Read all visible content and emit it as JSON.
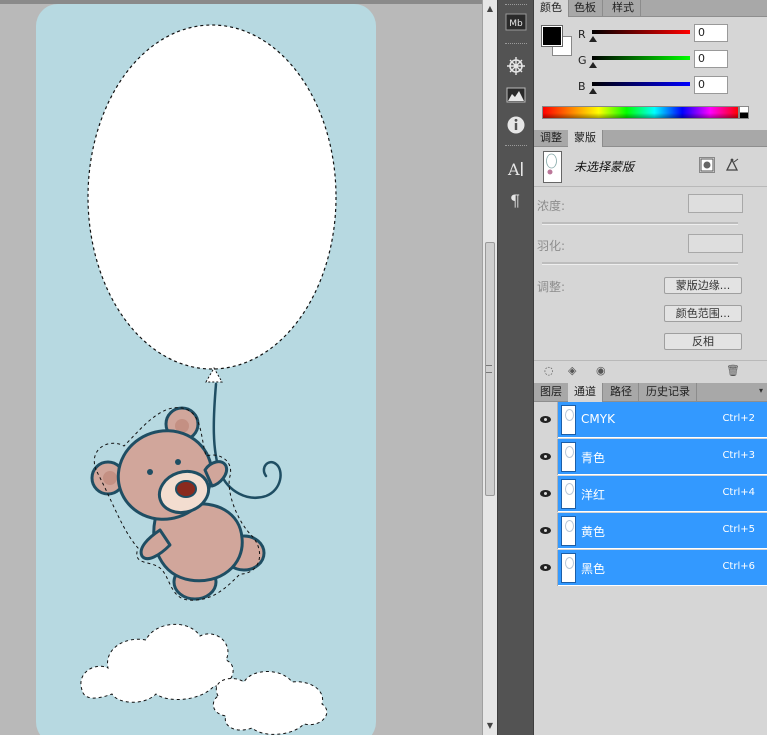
{
  "colors": {
    "canvas_bg": "#b7d9e1",
    "bear_body": "#d1a69b",
    "bear_outline": "#1f4e63",
    "string": "#1f4e63",
    "selection_row": "#3399ff"
  },
  "color_panel": {
    "tabs": [
      "颜色",
      "色板",
      "样式"
    ],
    "active_tab": "颜色",
    "sliders": [
      {
        "label": "R",
        "value": "0"
      },
      {
        "label": "G",
        "value": "0"
      },
      {
        "label": "B",
        "value": "0"
      }
    ]
  },
  "mask_panel": {
    "tabs": [
      "调整",
      "蒙版"
    ],
    "active_tab": "蒙版",
    "title": "未选择蒙版",
    "density_label": "浓度:",
    "feather_label": "羽化:",
    "refine_label": "调整:",
    "buttons": [
      "蒙版边缘...",
      "颜色范围...",
      "反相"
    ]
  },
  "channels_panel": {
    "tabs": [
      "图层",
      "通道",
      "路径",
      "历史记录"
    ],
    "active_tab": "通道",
    "channels": [
      {
        "name": "CMYK",
        "shortcut": "Ctrl+2"
      },
      {
        "name": "青色",
        "shortcut": "Ctrl+3"
      },
      {
        "name": "洋红",
        "shortcut": "Ctrl+4"
      },
      {
        "name": "黄色",
        "shortcut": "Ctrl+5"
      },
      {
        "name": "黑色",
        "shortcut": "Ctrl+6"
      }
    ]
  },
  "toolstrip": {
    "icons": [
      "mini-bridge-icon",
      "navigator-icon",
      "histogram-icon",
      "info-icon",
      "character-icon",
      "paragraph-icon"
    ],
    "mb_label": "Mb"
  }
}
